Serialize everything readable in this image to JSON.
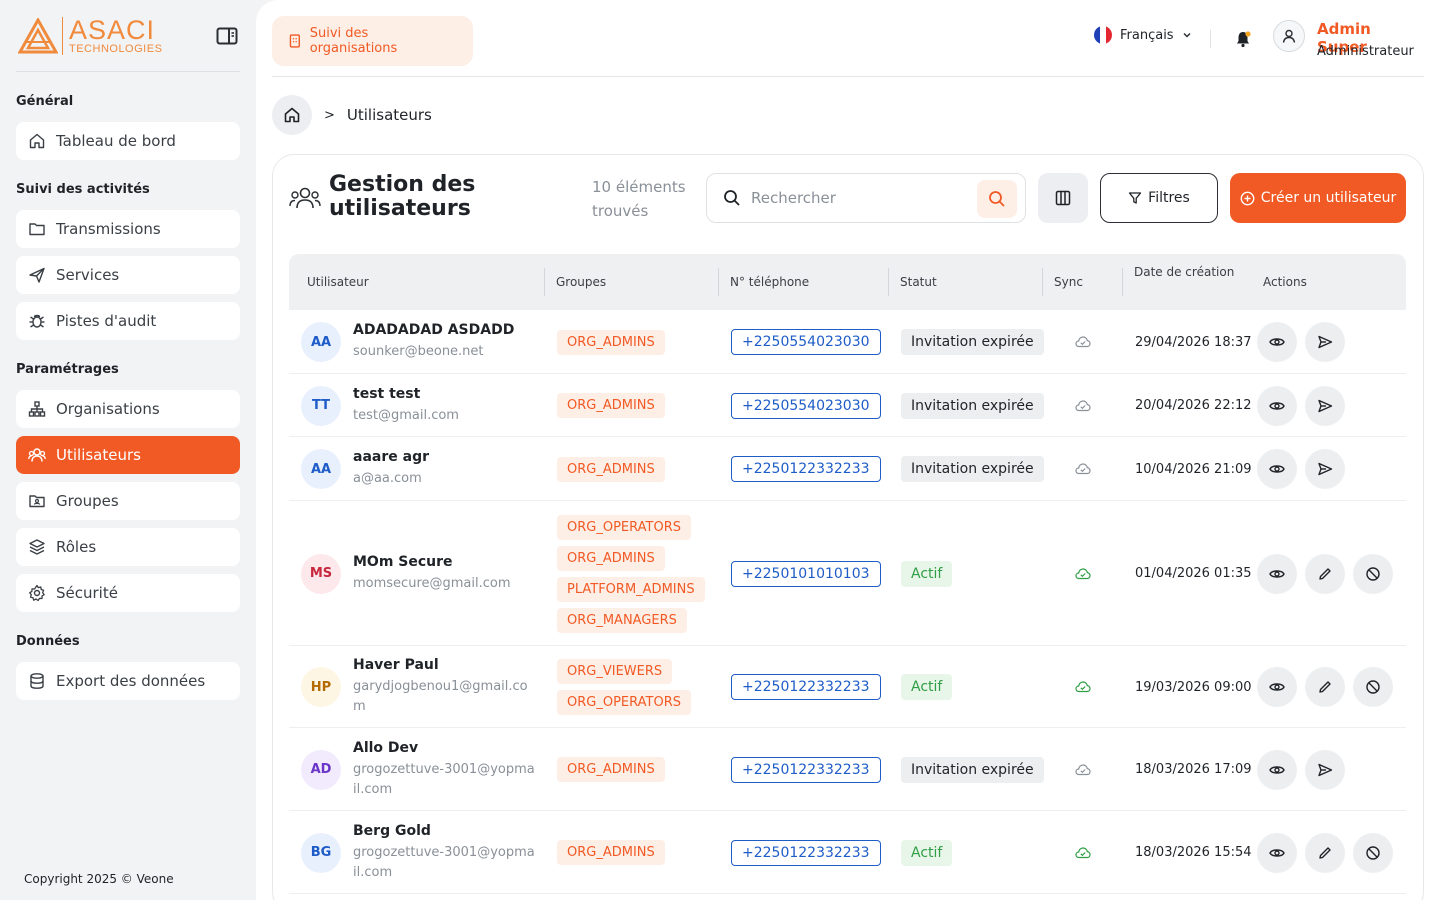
{
  "brand": {
    "name_big": "ASACI",
    "name_small": "TECHNOLOGIES"
  },
  "sidebar": {
    "sections": [
      {
        "title": "Général",
        "items": [
          {
            "label": "Tableau de bord",
            "icon": "home-icon",
            "active": false
          }
        ]
      },
      {
        "title": "Suivi des activités",
        "items": [
          {
            "label": "Transmissions",
            "icon": "folder-icon",
            "active": false
          },
          {
            "label": "Services",
            "icon": "send-icon",
            "active": false
          },
          {
            "label": "Pistes d'audit",
            "icon": "bug-icon",
            "active": false
          }
        ]
      },
      {
        "title": "Paramétrages",
        "items": [
          {
            "label": "Organisations",
            "icon": "hierarchy-icon",
            "active": false
          },
          {
            "label": "Utilisateurs",
            "icon": "users-icon",
            "active": true
          },
          {
            "label": "Groupes",
            "icon": "folder-group-icon",
            "active": false
          },
          {
            "label": "Rôles",
            "icon": "layers-icon",
            "active": false
          },
          {
            "label": "Sécurité",
            "icon": "gear-icon",
            "active": false
          }
        ]
      },
      {
        "title": "Données",
        "items": [
          {
            "label": "Export des données",
            "icon": "database-icon",
            "active": false
          }
        ]
      }
    ],
    "copyright": "Copyright 2025 © Veone"
  },
  "topbar": {
    "org_button": "Suivi des organisations",
    "language": "Français",
    "user_name": "Admin Super",
    "user_role": "Administrateur"
  },
  "breadcrumb": {
    "current": "Utilisateurs"
  },
  "page": {
    "title": "Gestion des utilisateurs",
    "count_text": "10 éléments trouvés",
    "search_placeholder": "Rechercher",
    "filters_label": "Filtres",
    "create_label": "Créer un utilisateur"
  },
  "table": {
    "columns": [
      "Utilisateur",
      "Groupes",
      "N° téléphone",
      "Statut",
      "Sync",
      "Date de création",
      "Actions"
    ],
    "rows": [
      {
        "initials": "AA",
        "name": "ADADADAD ASDADD",
        "email": "sounker@beone.net",
        "groups": [
          "ORG_ADMINS"
        ],
        "phone": "+2250554023030",
        "status": "Invitation expirée",
        "active": false,
        "date": "29/04/2026 18:37"
      },
      {
        "initials": "TT",
        "name": "test test",
        "email": "test@gmail.com",
        "groups": [
          "ORG_ADMINS"
        ],
        "phone": "+2250554023030",
        "status": "Invitation expirée",
        "active": false,
        "date": "20/04/2026 22:12"
      },
      {
        "initials": "AA",
        "name": "aaare agr",
        "email": "a@aa.com",
        "groups": [
          "ORG_ADMINS"
        ],
        "phone": "+2250122332233",
        "status": "Invitation expirée",
        "active": false,
        "date": "10/04/2026 21:09"
      },
      {
        "initials": "MS",
        "name": "MOm Secure",
        "email": "momsecure@gmail.com",
        "groups": [
          "ORG_OPERATORS",
          "ORG_ADMINS",
          "PLATFORM_ADMINS",
          "ORG_MANAGERS"
        ],
        "phone": "+2250101010103",
        "status": "Actif",
        "active": true,
        "date": "01/04/2026 01:35"
      },
      {
        "initials": "HP",
        "name": "Haver Paul",
        "email": "garydjogbenou1@gmail.com",
        "groups": [
          "ORG_VIEWERS",
          "ORG_OPERATORS"
        ],
        "phone": "+2250122332233",
        "status": "Actif",
        "active": true,
        "date": "19/03/2026 09:00"
      },
      {
        "initials": "AD",
        "name": "Allo Dev",
        "email": "grogozettuve-3001@yopmail.com",
        "groups": [
          "ORG_ADMINS"
        ],
        "phone": "+2250122332233",
        "status": "Invitation expirée",
        "active": false,
        "date": "18/03/2026 17:09"
      },
      {
        "initials": "BG",
        "name": "Berg Gold",
        "email": "grogozettuve-3001@yopmail.com",
        "groups": [
          "ORG_ADMINS"
        ],
        "phone": "+2250122332233",
        "status": "Actif",
        "active": true,
        "date": "18/03/2026 15:54"
      }
    ]
  },
  "colors": {
    "accent": "#f15a24",
    "phone": "#1e5cc8",
    "active": "#2f9e44"
  }
}
